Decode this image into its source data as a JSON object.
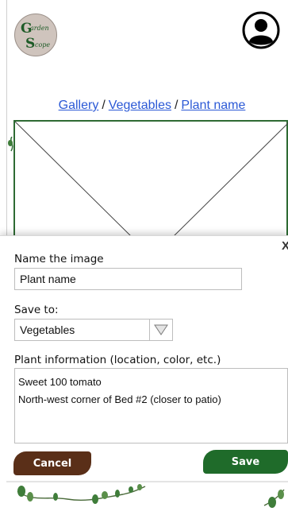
{
  "brand": {
    "logo_text_g": "G",
    "logo_text_arden": "arden",
    "logo_text_s": "S",
    "logo_text_cope": "cope"
  },
  "breadcrumb": {
    "items": [
      "Gallery",
      "Vegetables",
      "Plant name"
    ],
    "separator": "/"
  },
  "dialog": {
    "close_label": "X",
    "name_label": "Name the image",
    "name_value": "Plant name",
    "save_to_label": "Save to:",
    "save_to_value": "Vegetables",
    "info_label": "Plant information (location, color, etc.)",
    "info_lines": [
      "Sweet 100 tomato",
      "North-west corner of Bed #2 (closer to patio)"
    ],
    "cancel_label": "Cancel",
    "save_label": "Save"
  },
  "colors": {
    "accent_green": "#1f6b2a",
    "accent_brown": "#5a2f18",
    "link_blue": "#2b59d6"
  },
  "icons": [
    "user-avatar-icon",
    "dropdown-triangle-icon",
    "close-icon",
    "vine-decoration"
  ]
}
